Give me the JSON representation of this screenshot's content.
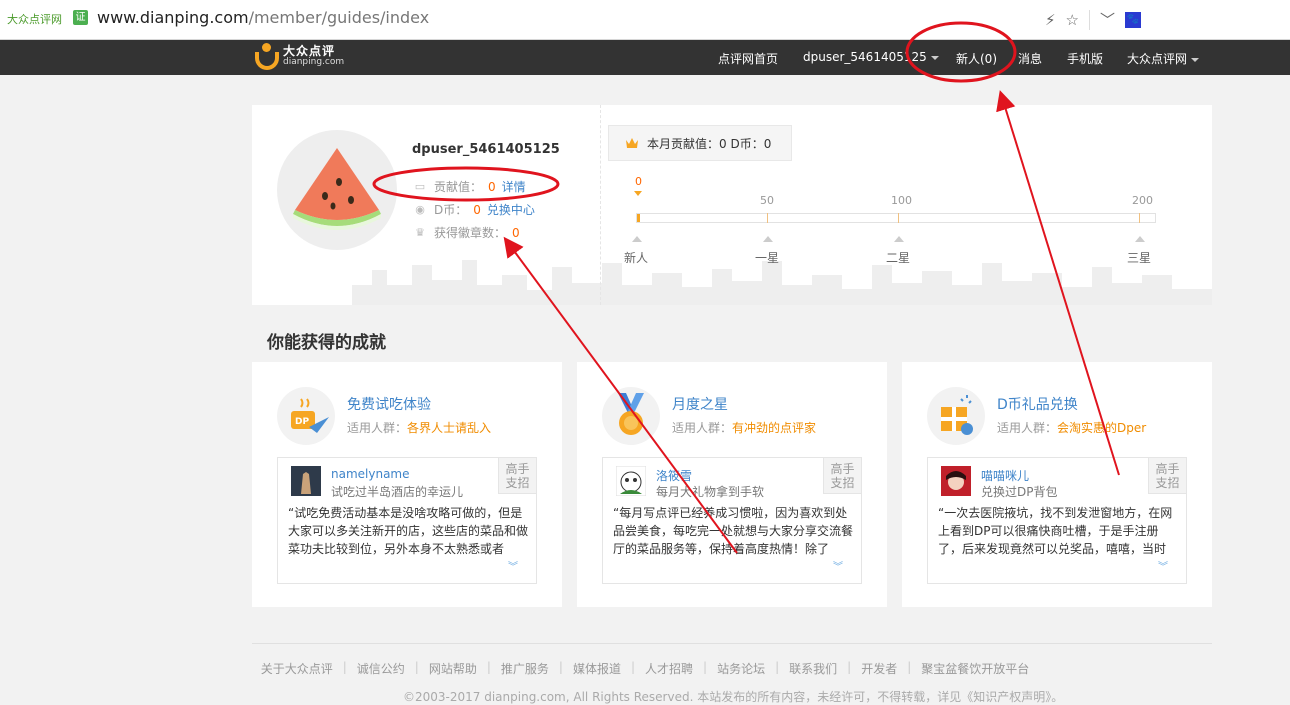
{
  "browser": {
    "site_identity": "大众点评网",
    "cert_label": "证",
    "url_host": "www.dianping.com",
    "url_path": "/member/guides/index"
  },
  "topnav": {
    "logo_cn": "大众点评",
    "logo_en": "dianping.com",
    "home": "点评网首页",
    "user": "dpuser_5461405125",
    "newbie": "新人(0)",
    "messages": "消息",
    "mobile": "手机版",
    "brand_menu": "大众点评网"
  },
  "profile": {
    "username": "dpuser_5461405125",
    "contribution_label": "贡献值：",
    "contribution_value": "0",
    "contribution_link": "详情",
    "dcoin_label": "D币：",
    "dcoin_value": "0",
    "dcoin_link": "兑换中心",
    "badges_label": "获得徽章数：",
    "badges_value": "0",
    "monthly_text": "本月贡献值：0  D币：0",
    "current_value": "0",
    "ticks": [
      {
        "value": "0",
        "level": "新人"
      },
      {
        "value": "50",
        "level": "一星"
      },
      {
        "value": "100",
        "level": "二星"
      },
      {
        "value": "200",
        "level": "三星"
      }
    ],
    "progress_fraction": 0.0
  },
  "section_title": "你能获得的成就",
  "cards": [
    {
      "title": "免费试吃体验",
      "audience_label": "适用人群：",
      "audience": "各界人士请乱入",
      "reviewer": "namelyname",
      "reviewer_desc": "试吃过半岛酒店的幸运儿",
      "badge_line1": "高手",
      "badge_line2": "支招",
      "review_text": "“试吃免费活动基本是没啥攻略可做的，但是大家可以多关注新开的店，这些店的菜品和做菜功夫比较到位，另外本身不太熟悉或者",
      "more": "︾"
    },
    {
      "title": "月度之星",
      "audience_label": "适用人群：",
      "audience": "有冲劲的点评家",
      "reviewer": "洛筱雪",
      "reviewer_desc": "每月大礼物拿到手软",
      "badge_line1": "高手",
      "badge_line2": "支招",
      "review_text": "“每月写点评已经养成习惯啦，因为喜欢到处品尝美食，每吃完一处就想与大家分享交流餐厅的菜品服务等，保持着高度热情！除了",
      "more": "︾"
    },
    {
      "title": "D币礼品兑换",
      "audience_label": "适用人群：",
      "audience": "会淘实惠的Dper",
      "reviewer": "喵喵咪儿",
      "reviewer_desc": "兑换过DP背包",
      "badge_line1": "高手",
      "badge_line2": "支招",
      "review_text": "“一次去医院掖坑，找不到发泄窗地方，在网上看到DP可以很痛快商吐槽，于是手注册了，后来发现竟然可以兑奖品，嘻嘻，当时",
      "more": "︾"
    }
  ],
  "footer": {
    "links": [
      "关于大众点评",
      "诚信公约",
      "网站帮助",
      "推广服务",
      "媒体报道",
      "人才招聘",
      "站务论坛",
      "联系我们",
      "开发者",
      "聚宝盆餐饮开放平台"
    ],
    "copyright": "©2003-2017 dianping.com, All Rights Reserved.        本站发布的所有内容，未经许可，不得转载，详见《知识产权声明》。"
  },
  "colors": {
    "nav_bg": "#333333",
    "link_blue": "#3f84c9",
    "accent_orange": "#f66000",
    "annotation_red": "#e0141e"
  }
}
